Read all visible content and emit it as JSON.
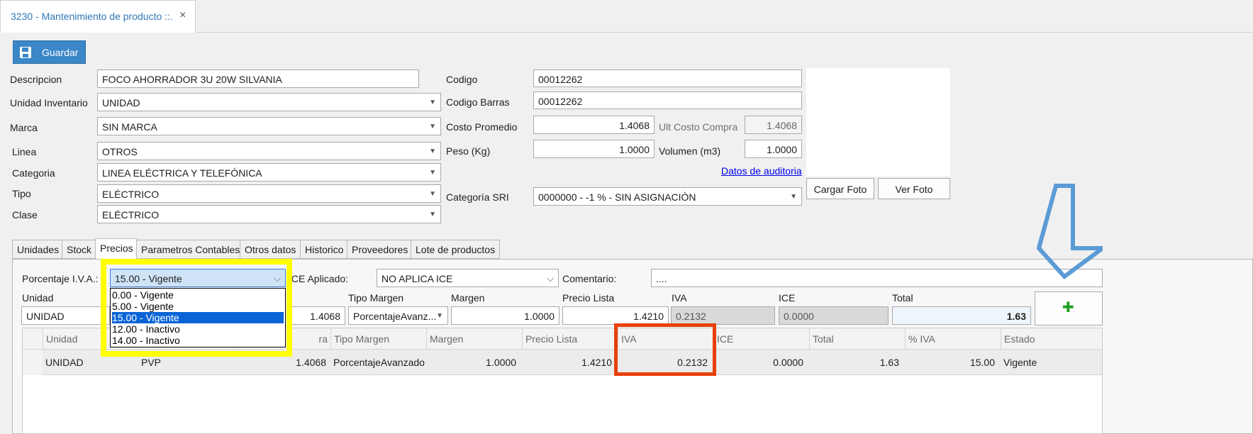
{
  "window": {
    "tab_title": "3230 - Mantenimiento de producto ::.",
    "close_glyph": "×"
  },
  "toolbar": {
    "save_label": "Guardar"
  },
  "form": {
    "descripcion": {
      "label": "Descripcion",
      "value": "FOCO AHORRADOR 3U 20W SILVANIA"
    },
    "unidad_inventario": {
      "label": "Unidad Inventario",
      "value": "UNIDAD"
    },
    "marca": {
      "label": "Marca",
      "value": "SIN MARCA"
    },
    "linea": {
      "label": "Linea",
      "value": "OTROS"
    },
    "categoria": {
      "label": "Categoria",
      "value": "LINEA ELÉCTRICA Y TELEFÓNICA"
    },
    "tipo": {
      "label": "Tipo",
      "value": "ELÉCTRICO"
    },
    "clase": {
      "label": "Clase",
      "value": "ELÉCTRICO"
    },
    "codigo": {
      "label": "Codigo",
      "value": "00012262"
    },
    "codigo_barras": {
      "label": "Codigo Barras",
      "value": "00012262"
    },
    "costo_promedio": {
      "label": "Costo Promedio",
      "value": "1.4068"
    },
    "ult_costo_compra": {
      "label": "Ult Costo Compra",
      "value": "1.4068"
    },
    "peso": {
      "label": "Peso (Kg)",
      "value": "1.0000"
    },
    "volumen": {
      "label": "Volumen (m3)",
      "value": "1.0000"
    },
    "auditoria_link": "Datos de auditoria",
    "categoria_sri": {
      "label": "Categoría SRI",
      "value": "0000000 - -1 % - SIN ASIGNACIÒN"
    },
    "cargar_foto": "Cargar Foto",
    "ver_foto": "Ver Foto"
  },
  "tabs": [
    "Unidades",
    "Stock",
    "Precios",
    "Parametros Contables",
    "Otros datos",
    "Historico",
    "Proveedores",
    "Lote de productos"
  ],
  "active_tab": "Precios",
  "precios": {
    "iva_label": "Porcentaje I.V.A.:",
    "iva_value": "15.00 - Vigente",
    "iva_options": [
      "0.00 - Vigente",
      "5.00 - Vigente",
      "15.00 - Vigente",
      "12.00 - Inactivo",
      "14.00 - Inactivo"
    ],
    "iva_selected_index": 2,
    "ice_label": "ICE Aplicado:",
    "ice_value": "NO APLICA ICE",
    "comentario_label": "Comentario:",
    "comentario_value": "....",
    "edit_headers": {
      "unidad": "Unidad",
      "tipo_margen": "Tipo Margen",
      "margen": "Margen",
      "precio_lista": "Precio Lista",
      "iva": "IVA",
      "ice": "ICE",
      "total": "Total"
    },
    "edit_row": {
      "unidad": "UNIDAD",
      "costo": "1.4068",
      "tipo_margen": "PorcentajeAvanz...",
      "margen": "1.0000",
      "precio_lista": "1.4210",
      "iva": "0.2132",
      "ice": "0.0000",
      "total": "1.63"
    },
    "add_icon": "✚",
    "grid_headers": [
      "Unidad",
      "",
      "ra",
      "Tipo Margen",
      "Margen",
      "Precio Lista",
      "IVA",
      "ICE",
      "Total",
      "% IVA",
      "Estado"
    ],
    "grid_rows": [
      [
        "UNIDAD",
        "PVP",
        "1.4068",
        "PorcentajeAvanzado",
        "1.0000",
        "1.4210",
        "0.2132",
        "0.0000",
        "1.63",
        "15.00",
        "Vigente"
      ]
    ]
  },
  "annotations": {
    "highlight_color": "#ffff00",
    "box_color": "#e8400c",
    "arrow_color": "#5b9bd5"
  }
}
